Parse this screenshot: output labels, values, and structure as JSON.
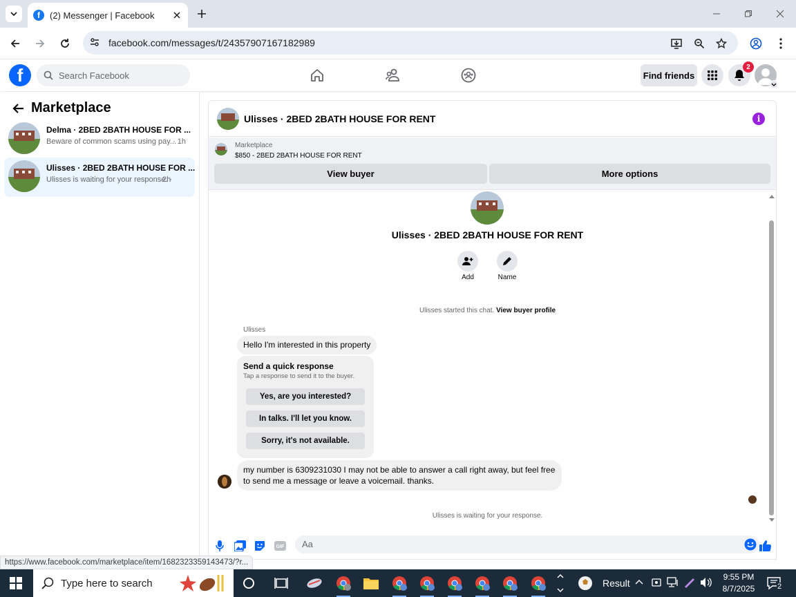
{
  "browser": {
    "tab_title": "(2) Messenger | Facebook",
    "url": "facebook.com/messages/t/24357907167182989"
  },
  "fb": {
    "logo_letter": "f",
    "search_placeholder": "Search Facebook",
    "find_friends": "Find friends",
    "notification_count": "2"
  },
  "sidebar": {
    "title": "Marketplace",
    "conversations": [
      {
        "name": "Delma · 2BED 2BATH HOUSE FOR ...",
        "preview": "Beware of common scams using pay...",
        "time": "· 1h",
        "selected": false
      },
      {
        "name": "Ulisses · 2BED 2BATH HOUSE FOR ...",
        "preview": "Ulisses is waiting for your response. ·",
        "time": "2h",
        "selected": true
      }
    ]
  },
  "chat": {
    "title": "Ulisses · 2BED 2BATH HOUSE FOR RENT",
    "listing_category": "Marketplace",
    "listing_price": "$850 - 2BED 2BATH HOUSE FOR RENT",
    "view_buyer": "View buyer",
    "more_options": "More options",
    "profile_title": "Ulisses · 2BED 2BATH HOUSE FOR RENT",
    "add_label": "Add",
    "name_label": "Name",
    "started_text": "Ulisses started this chat.",
    "view_buyer_profile": "View buyer profile",
    "sender": "Ulisses",
    "message1": "Hello I'm interested in this property",
    "quick_title": "Send a quick response",
    "quick_subtitle": "Tap a response to send it to the buyer.",
    "quick_replies": [
      "Yes, are you interested?",
      "In talks. I'll let you know.",
      "Sorry, it's not available."
    ],
    "message2": "my number is 6309231030 I may not be able to answer a call right away, but feel free to send me a message or leave a voicemail. thanks.",
    "waiting": "Ulisses is waiting for your response.",
    "composer_placeholder": "Aa"
  },
  "status_url": "https://www.facebook.com/marketplace/item/1682323359143473/?r...",
  "taskbar": {
    "search_placeholder": "Type here to search",
    "weather": "Result",
    "time": "9:55 PM",
    "date": "8/7/2025",
    "notif_count": "2"
  },
  "colors": {
    "fb_blue": "#0866ff",
    "accent_purple": "#9b22dc",
    "badge_red": "#e41e3f",
    "taskbar": "#1c2b39"
  }
}
